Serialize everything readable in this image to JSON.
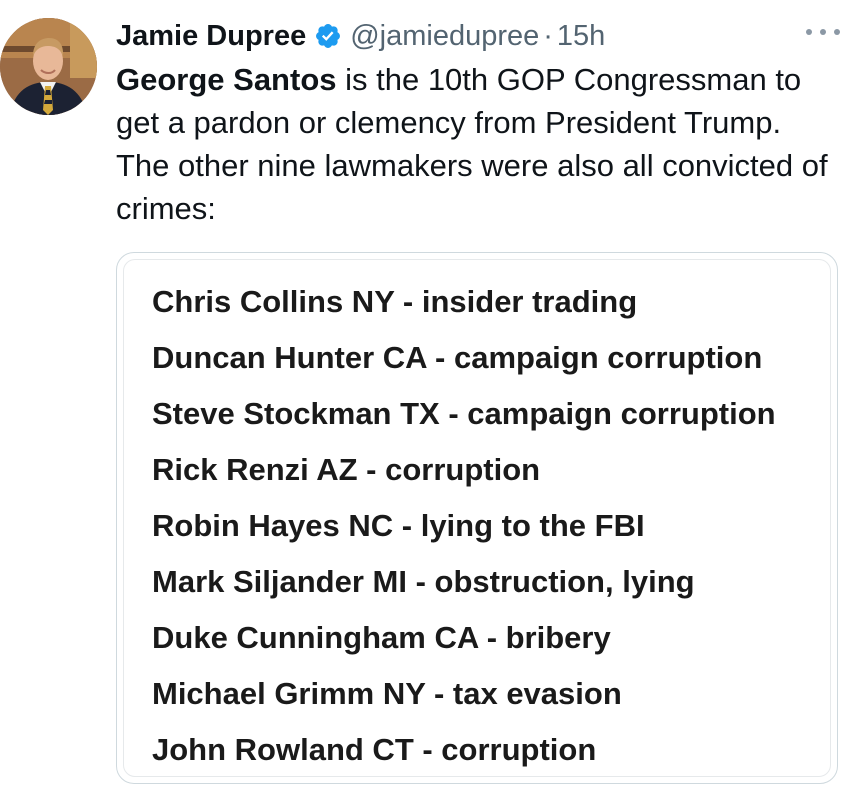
{
  "author": {
    "display_name": "Jamie Dupree",
    "handle": "@jamiedupree",
    "separator": "·",
    "timestamp": "15h",
    "verified": true
  },
  "tweet": {
    "bold_lead": "George Santos",
    "text_rest": " is the 10th GOP Congressman to get a pardon or clemency from President Trump.  The other nine lawmakers were also all convicted of crimes:"
  },
  "image_list": [
    "Chris Collins NY - insider trading",
    "Duncan Hunter CA - campaign corruption",
    "Steve Stockman TX - campaign corruption",
    "Rick Renzi AZ - corruption",
    "Robin Hayes NC - lying to the FBI",
    "Mark Siljander MI - obstruction, lying",
    "Duke Cunningham CA - bribery",
    "Michael Grimm NY - tax evasion",
    "John Rowland CT - corruption"
  ],
  "icons": {
    "verified": "verified-badge-icon",
    "more": "more-options-icon"
  },
  "colors": {
    "verified_blue": "#1d9bf0",
    "secondary_text": "#536471",
    "primary_text": "#0f1419",
    "card_border": "#cfd9de"
  }
}
